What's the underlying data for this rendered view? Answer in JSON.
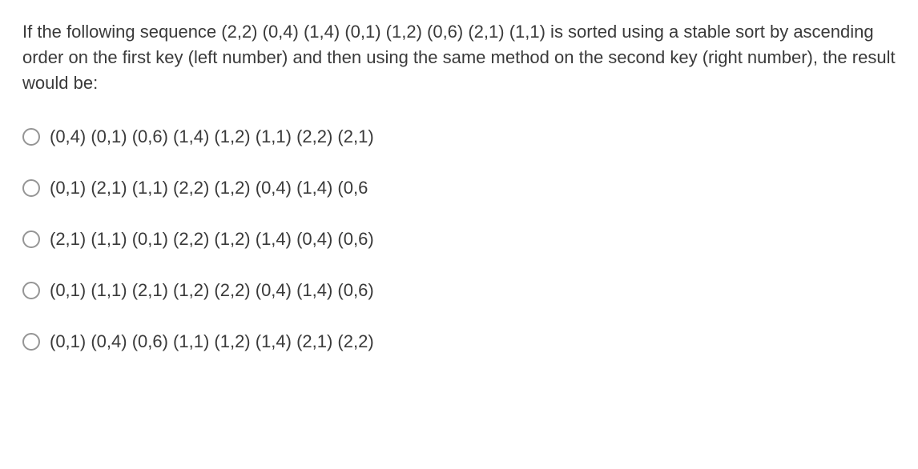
{
  "question": "If the following sequence (2,2) (0,4) (1,4) (0,1) (1,2) (0,6) (2,1) (1,1) is sorted using a stable sort by ascending order on the first key (left number) and then using the same method on the second key (right number), the result would be:",
  "options": [
    "(0,4) (0,1) (0,6) (1,4) (1,2) (1,1) (2,2) (2,1)",
    "(0,1) (2,1) (1,1) (2,2) (1,2) (0,4) (1,4) (0,6",
    "(2,1) (1,1) (0,1) (2,2) (1,2) (1,4) (0,4) (0,6)",
    "(0,1) (1,1) (2,1) (1,2) (2,2) (0,4) (1,4) (0,6)",
    "(0,1) (0,4) (0,6) (1,1) (1,2) (1,4) (2,1) (2,2)"
  ]
}
